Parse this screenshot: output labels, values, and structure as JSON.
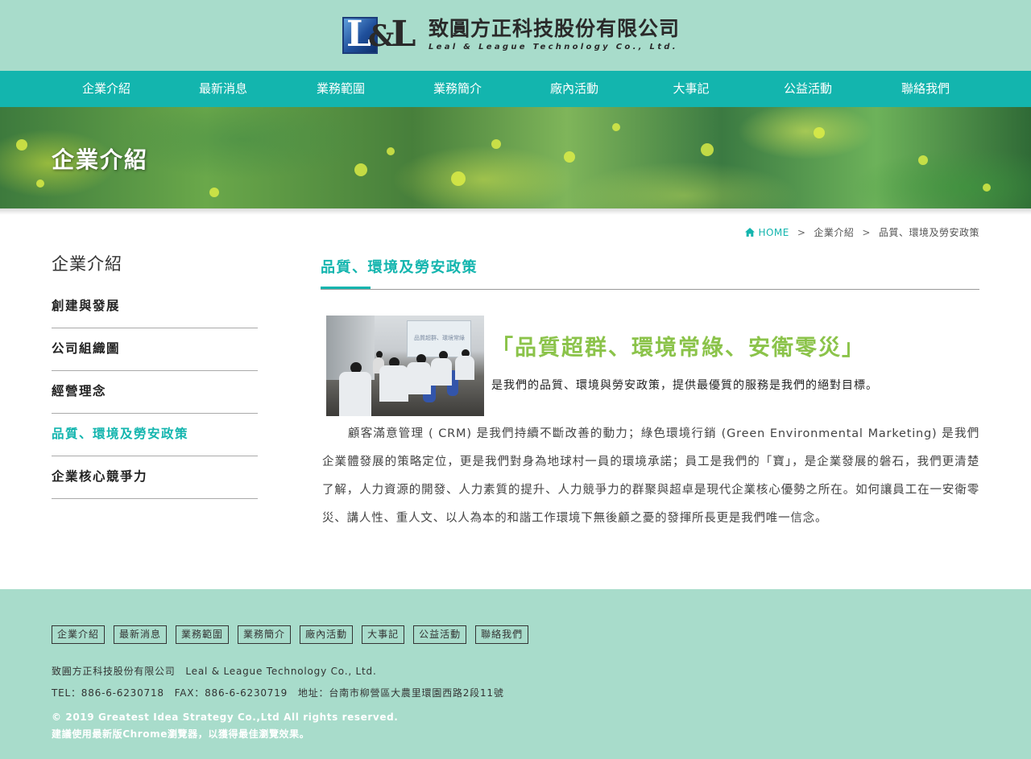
{
  "header": {
    "logo_letters_1": "L",
    "logo_letters_amp": "&",
    "logo_letters_2": "L",
    "company_cn": "致圓方正科技股份有限公司",
    "company_en": "Leal & League Technology Co., Ltd."
  },
  "nav": {
    "items": [
      "企業介紹",
      "最新消息",
      "業務範圍",
      "業務簡介",
      "廠內活動",
      "大事記",
      "公益活動",
      "聯絡我們"
    ]
  },
  "banner": {
    "title": "企業介紹"
  },
  "breadcrumb": {
    "home": "HOME",
    "sep": ">",
    "level1": "企業介紹",
    "level2": "品質、環境及勞安政策"
  },
  "sidebar": {
    "title": "企業介紹",
    "items": [
      "創建與發展",
      "公司組織圖",
      "經營理念",
      "品質、環境及勞安政策",
      "企業核心競爭力"
    ],
    "active_index": 3
  },
  "main": {
    "title": "品質、環境及勞安政策",
    "photo_screen_text": "品質超群、環境常綠",
    "slogan": "「品質超群、環境常綠、安衛零災」",
    "policy": "是我們的品質、環境與勞安政策，提供最優質的服務是我們的絕對目標。",
    "body": "顧客滿意管理 ( CRM) 是我們持續不斷改善的動力；綠色環境行銷 (Green Environmental Marketing) 是我們企業體發展的策略定位，更是我們對身為地球村一員的環境承諾；員工是我們的「寶」，是企業發展的磐石，我們更清楚了解，人力資源的開發、人力素質的提升、人力競爭力的群聚與超卓是現代企業核心優勢之所在。如何讓員工在一安衛零災、講人性、重人文、以人為本的和諧工作環境下無後顧之憂的發揮所長更是我們唯一信念。"
  },
  "footer": {
    "links": [
      "企業介紹",
      "最新消息",
      "業務範圍",
      "業務簡介",
      "廠內活動",
      "大事記",
      "公益活動",
      "聯絡我們"
    ],
    "company_line": "致圓方正科技股份有限公司　Leal & League Technology Co., Ltd.",
    "contact_line": "TEL：886-6-6230718　FAX：886-6-6230719　地址：台南市柳營區大農里環園西路2段11號",
    "copyright": "© 2019 Greatest Idea Strategy Co.,Ltd All rights reserved.",
    "browser_note": "建議使用最新版Chrome瀏覽器，以獲得最佳瀏覽效果。"
  },
  "colors": {
    "header_bg": "#a8dccb",
    "nav_bg": "#13b5ae",
    "accent": "#13b5ae",
    "slogan": "#8bc34a"
  }
}
